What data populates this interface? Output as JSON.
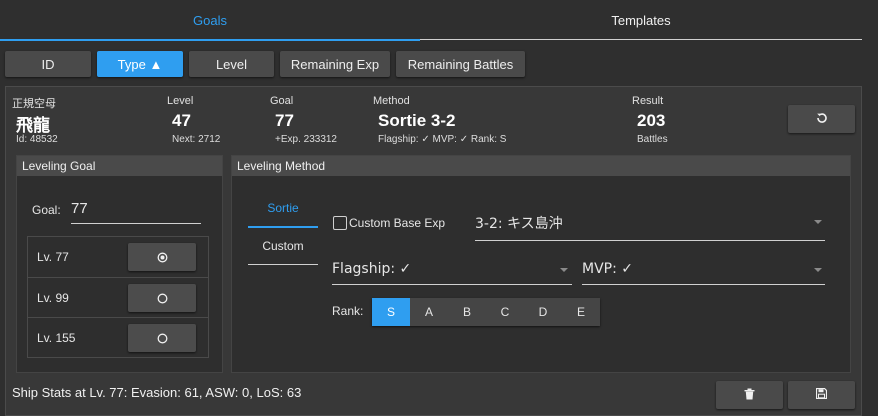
{
  "tabs": [
    {
      "label": "Goals",
      "active": true
    },
    {
      "label": "Templates",
      "active": false
    }
  ],
  "sort_buttons": [
    {
      "label": "ID",
      "active": false
    },
    {
      "label": "Type ▲",
      "active": true
    },
    {
      "label": "Level",
      "active": false
    },
    {
      "label": "Remaining Exp",
      "active": false
    },
    {
      "label": "Remaining Battles",
      "active": false
    }
  ],
  "ship": {
    "type": "正規空母",
    "name": "飛龍",
    "id_text": "Id: 48532"
  },
  "level": {
    "label": "Level",
    "value": "47",
    "sub": "Next: 2712"
  },
  "goal": {
    "label": "Goal",
    "value": "77",
    "sub": "+Exp. 233312"
  },
  "method": {
    "label": "Method",
    "value": "Sortie 3-2",
    "sub": "Flagship: ✓ MVP: ✓ Rank: S"
  },
  "result": {
    "label": "Result",
    "value": "203",
    "sub": "Battles"
  },
  "leveling_goal": {
    "title": "Leveling Goal",
    "goal_label": "Goal:",
    "goal_value": "77",
    "options": [
      {
        "label": "Lv. 77",
        "selected": true
      },
      {
        "label": "Lv. 99",
        "selected": false
      },
      {
        "label": "Lv. 155",
        "selected": false
      }
    ]
  },
  "leveling_method": {
    "title": "Leveling Method",
    "tabs": [
      {
        "label": "Sortie",
        "active": true
      },
      {
        "label": "Custom",
        "active": false
      }
    ],
    "custom_base_exp_label": "Custom Base Exp",
    "map_value": "3-2: キス島沖",
    "flagship_value": "Flagship: ✓",
    "mvp_value": "MVP: ✓",
    "rank_label": "Rank:",
    "ranks": [
      "S",
      "A",
      "B",
      "C",
      "D",
      "E"
    ],
    "rank_selected": "S"
  },
  "stats_text": "Ship Stats at Lv. 77: Evasion: 61, ASW: 0, LoS: 63",
  "icons": {
    "reset": "undo-icon",
    "delete": "trash-icon",
    "save": "save-icon",
    "radio_on": "radio-checked-icon",
    "radio_off": "radio-unchecked-icon",
    "caret": "caret-down-icon"
  },
  "colors": {
    "accent": "#2f9ef0",
    "background": "#2f2f2f",
    "button": "#4a4a4a"
  }
}
